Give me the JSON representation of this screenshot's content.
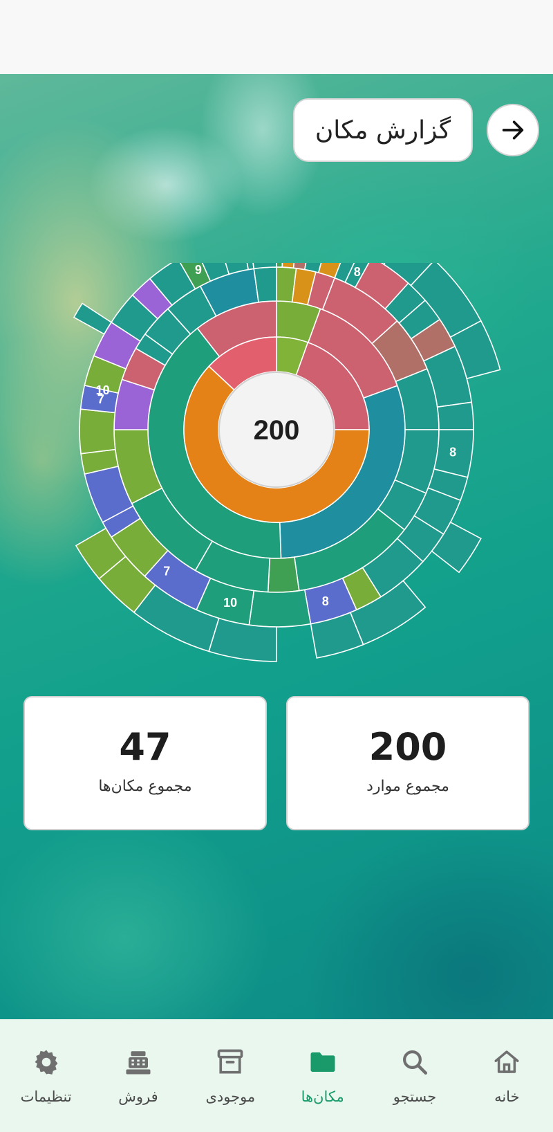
{
  "header": {
    "title": "گزارش مکان"
  },
  "chart_data": {
    "type": "sunburst",
    "center_total": "200",
    "inner_ring": [
      {
        "value": 11,
        "color": "#80b338"
      },
      {
        "value": 39,
        "color": "#ce6070"
      },
      {
        "value": 124,
        "color": "#e58217"
      },
      {
        "value": 26,
        "color": "#e2606e"
      }
    ],
    "segment_labels": [
      "9",
      "8",
      "10",
      "7",
      "8",
      "7",
      "10",
      "8"
    ]
  },
  "stats": [
    {
      "value": "200",
      "label": "مجموع موارد"
    },
    {
      "value": "47",
      "label": "مجموع مکان‌ها"
    }
  ],
  "nav": {
    "items": [
      {
        "label": "خانه",
        "icon": "home-icon"
      },
      {
        "label": "جستجو",
        "icon": "search-icon"
      },
      {
        "label": "مکان‌ها",
        "icon": "folder-icon",
        "active": true
      },
      {
        "label": "موجودی",
        "icon": "archive-icon"
      },
      {
        "label": "فروش",
        "icon": "cash-register-icon"
      },
      {
        "label": "تنظیمات",
        "icon": "gear-icon"
      }
    ],
    "active_color": "#1a9a6a",
    "inactive_color": "#6f6f6f"
  }
}
